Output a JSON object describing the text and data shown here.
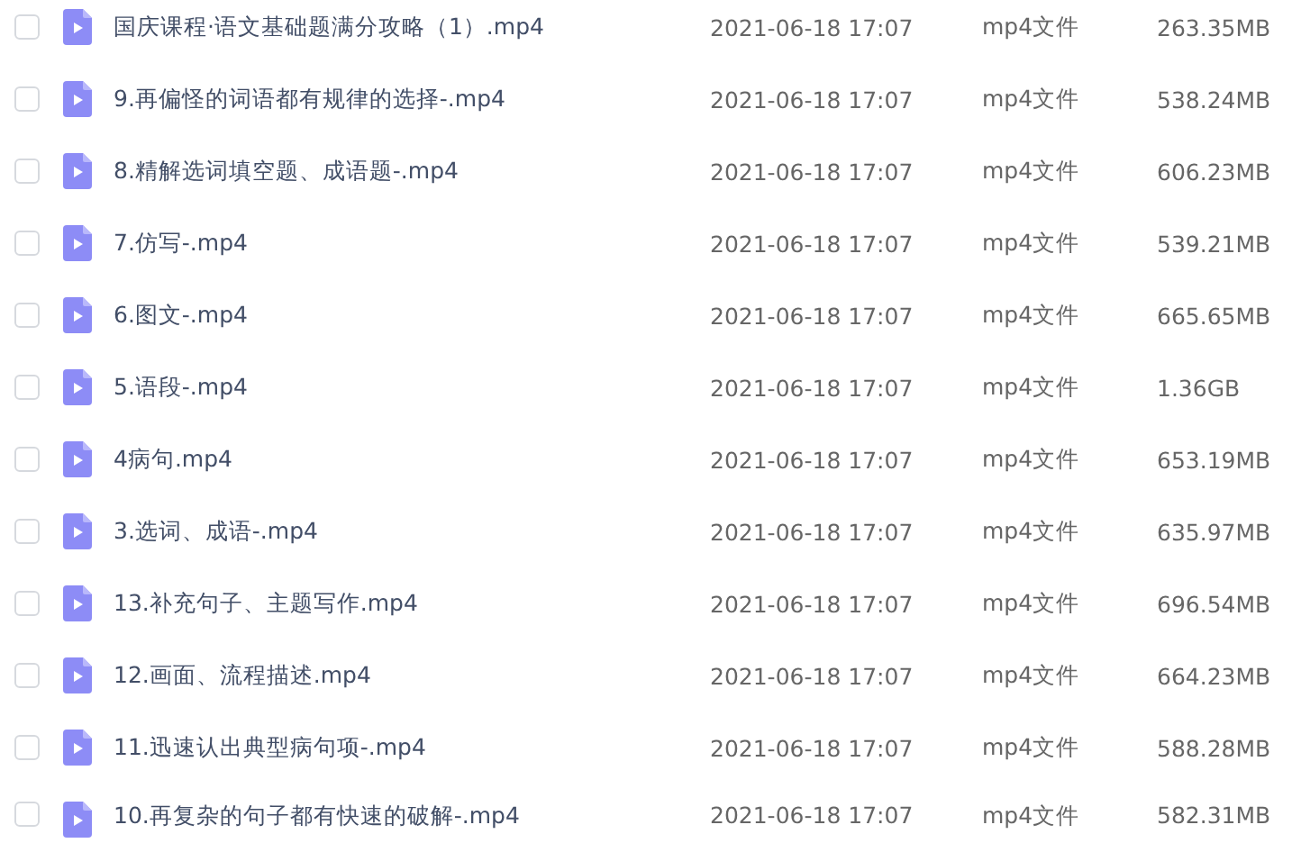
{
  "files": [
    {
      "name": "国庆课程·语文基础题满分攻略（1）.mp4",
      "modified": "2021-06-18 17:07",
      "type": "mp4文件",
      "size": "263.35MB",
      "checked": false
    },
    {
      "name": "9.再偏怪的词语都有规律的选择-.mp4",
      "modified": "2021-06-18 17:07",
      "type": "mp4文件",
      "size": "538.24MB",
      "checked": false
    },
    {
      "name": "8.精解选词填空题、成语题-.mp4",
      "modified": "2021-06-18 17:07",
      "type": "mp4文件",
      "size": "606.23MB",
      "checked": false
    },
    {
      "name": "7.仿写-.mp4",
      "modified": "2021-06-18 17:07",
      "type": "mp4文件",
      "size": "539.21MB",
      "checked": false
    },
    {
      "name": "6.图文-.mp4",
      "modified": "2021-06-18 17:07",
      "type": "mp4文件",
      "size": "665.65MB",
      "checked": false
    },
    {
      "name": "5.语段-.mp4",
      "modified": "2021-06-18 17:07",
      "type": "mp4文件",
      "size": "1.36GB",
      "checked": false
    },
    {
      "name": "4病句.mp4",
      "modified": "2021-06-18 17:07",
      "type": "mp4文件",
      "size": "653.19MB",
      "checked": false
    },
    {
      "name": "3.选词、成语-.mp4",
      "modified": "2021-06-18 17:07",
      "type": "mp4文件",
      "size": "635.97MB",
      "checked": false
    },
    {
      "name": "13.补充句子、主题写作.mp4",
      "modified": "2021-06-18 17:07",
      "type": "mp4文件",
      "size": "696.54MB",
      "checked": false
    },
    {
      "name": "12.画面、流程描述.mp4",
      "modified": "2021-06-18 17:07",
      "type": "mp4文件",
      "size": "664.23MB",
      "checked": false
    },
    {
      "name": "11.迅速认出典型病句项-.mp4",
      "modified": "2021-06-18 17:07",
      "type": "mp4文件",
      "size": "588.28MB",
      "checked": false
    },
    {
      "name": "10.再复杂的句子都有快速的破解-.mp4",
      "modified": "2021-06-18 17:07",
      "type": "mp4文件",
      "size": "582.31MB",
      "checked": false
    }
  ]
}
